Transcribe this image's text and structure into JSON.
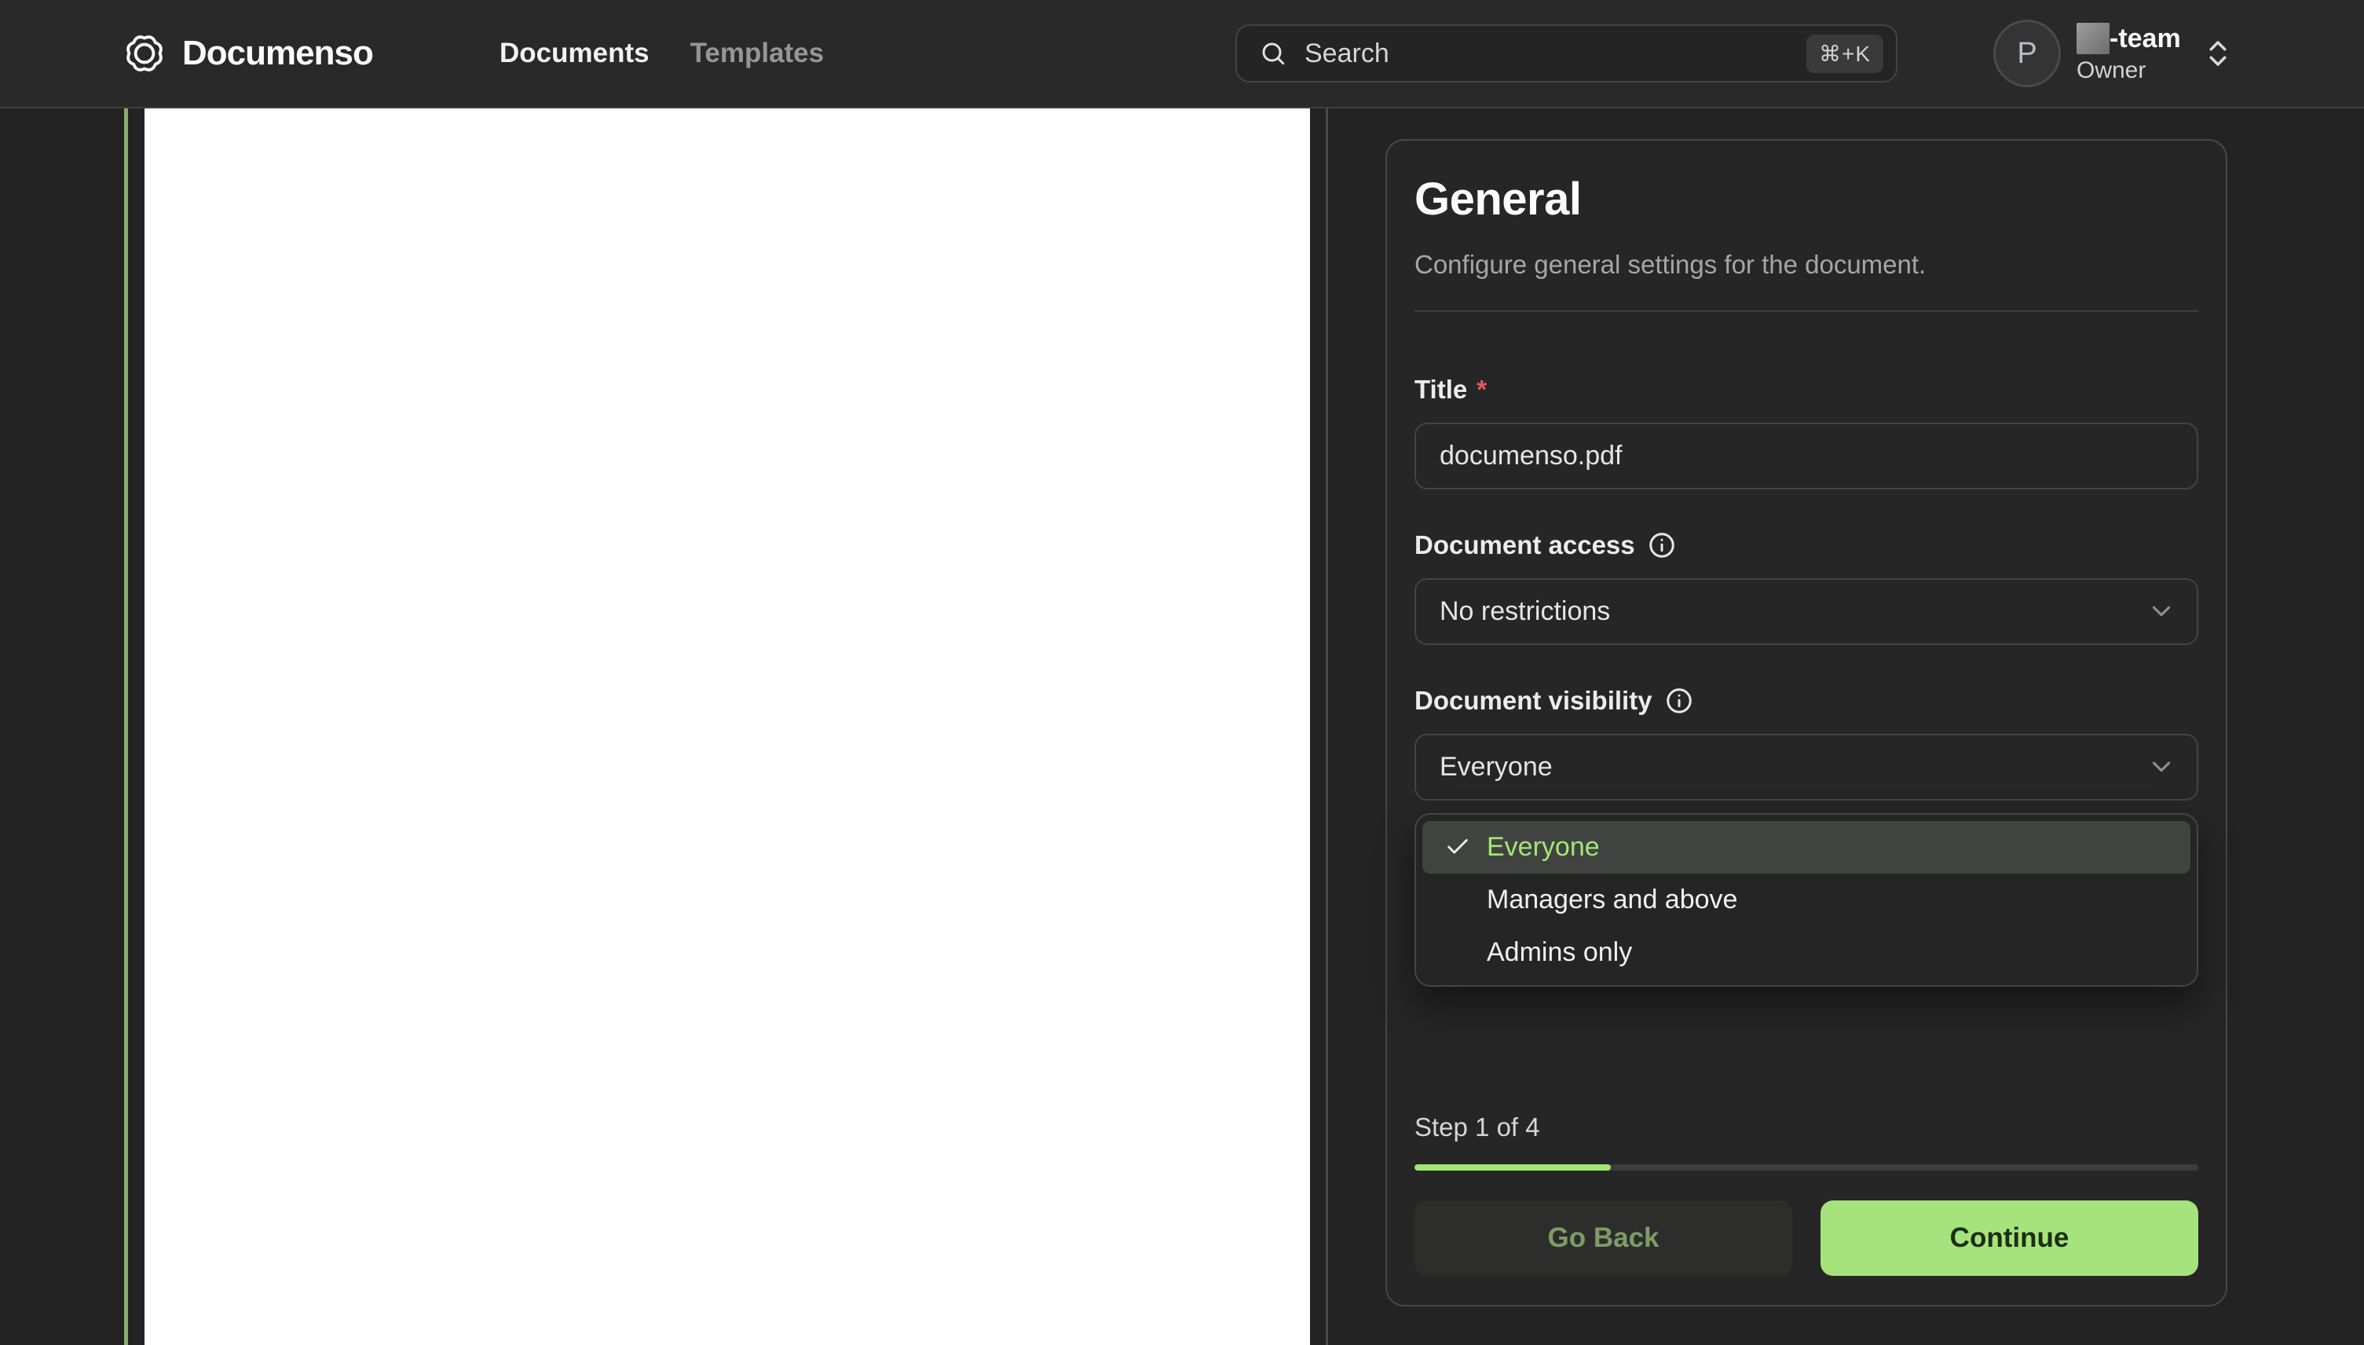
{
  "navbar": {
    "brand": "Documenso",
    "nav_items": [
      {
        "label": "Documents",
        "active": true
      },
      {
        "label": "Templates",
        "active": false
      }
    ],
    "search": {
      "placeholder": "Search",
      "shortcut": "⌘+K"
    },
    "account": {
      "avatar_initial": "P",
      "team_suffix": "-team",
      "role": "Owner"
    }
  },
  "panel": {
    "title": "General",
    "subtitle": "Configure general settings for the document.",
    "fields": {
      "title": {
        "label": "Title",
        "required_mark": "*",
        "value": "documenso.pdf"
      },
      "access": {
        "label": "Document access",
        "value": "No restrictions"
      },
      "visibility": {
        "label": "Document visibility",
        "value": "Everyone"
      }
    },
    "visibility_options": [
      {
        "label": "Everyone",
        "selected": true
      },
      {
        "label": "Managers and above",
        "selected": false
      },
      {
        "label": "Admins only",
        "selected": false
      }
    ],
    "step": {
      "text": "Step 1 of 4",
      "progress_percent": 25
    },
    "buttons": {
      "back": "Go Back",
      "continue": "Continue"
    }
  },
  "icons": {
    "logo": "documenso-rosette",
    "search": "magnifying-glass",
    "account_caret": "chevrons-up-down",
    "info": "circle-info",
    "select_caret": "chevron-down",
    "selected_check": "check"
  },
  "colors": {
    "accent_green": "#a2e771",
    "continue_bg": "#a7e37d",
    "continue_text": "#1b2f12",
    "go_back_text": "#7d9c66",
    "doc_accent_line": "#8cab6d",
    "required_mark": "#e5595f",
    "selected_option_text": "#a3e674",
    "card_bg": "#262626",
    "navbar_bg": "#292929"
  }
}
